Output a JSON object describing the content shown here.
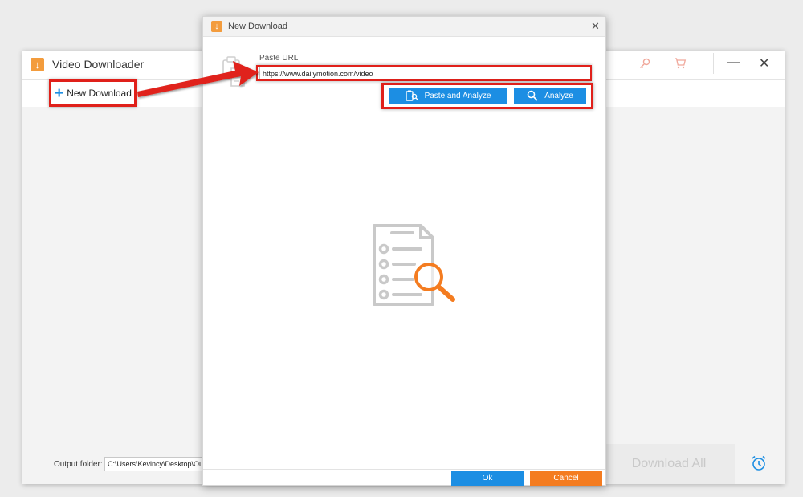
{
  "main_window": {
    "title": "Video Downloader",
    "logo_icon": "download-arrow-icon",
    "toolbar": {
      "new_download_label": "New Download"
    },
    "bottom": {
      "output_folder_label": "Output folder:",
      "output_folder_value": "C:\\Users\\Kevincy\\Desktop\\Out",
      "download_all_label": "Download All"
    },
    "controls": [
      "key-icon",
      "cart-icon",
      "minimize-icon",
      "close-icon",
      "alarm-clock-icon"
    ]
  },
  "dialog": {
    "title": "New Download",
    "paste_url_label": "Paste URL",
    "url_value": "https://www.dailymotion.com/video",
    "paste_analyze_label": "Paste and Analyze",
    "analyze_label": "Analyze",
    "ok_label": "Ok",
    "cancel_label": "Cancel"
  },
  "colors": {
    "accent_blue": "#1c8ee3",
    "accent_orange": "#f47c20",
    "highlight_red": "#e0201a"
  }
}
